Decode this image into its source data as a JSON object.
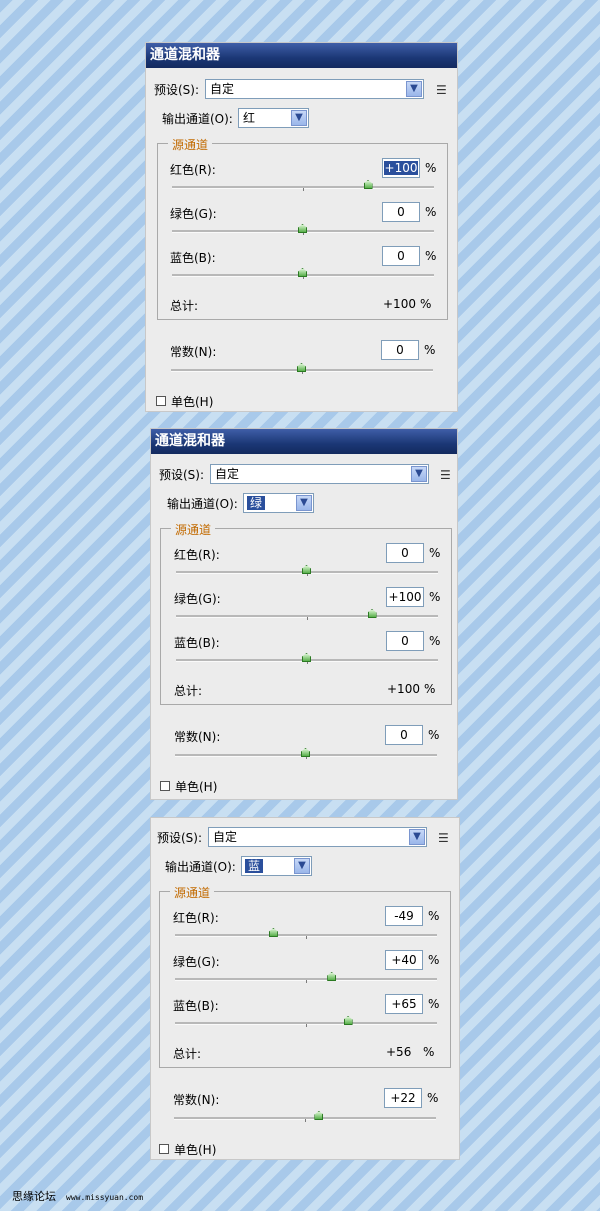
{
  "common": {
    "preset_label": "预设(S):",
    "output_label": "输出通道(O):",
    "source_legend": "源通道",
    "red_label": "红色(R):",
    "green_label": "绿色(G):",
    "blue_label": "蓝色(B):",
    "total_label": "总计:",
    "constant_label": "常数(N):",
    "mono_label": "单色(H)",
    "percent": "%",
    "combo_arrow_icon": "chevron-down-icon",
    "menu_icon": "panel-menu-icon",
    "slider_thumb_icon": "slider-thumb-icon"
  },
  "panels": [
    {
      "title": "通道混和器",
      "preset_value": "自定",
      "output_value": "红",
      "red": "+100",
      "green": "0",
      "blue": "0",
      "total": "+100",
      "constant": "0",
      "mono_checked": false,
      "slider_levels_percent": {
        "red": 100,
        "green": 0,
        "blue": 0,
        "constant": 0
      }
    },
    {
      "title": "通道混和器",
      "preset_value": "自定",
      "output_value": "绿",
      "red": "0",
      "green": "+100",
      "blue": "0",
      "total": "+100",
      "constant": "0",
      "mono_checked": false,
      "slider_levels_percent": {
        "red": 0,
        "green": 100,
        "blue": 0,
        "constant": 0
      }
    },
    {
      "title": "",
      "preset_value": "自定",
      "output_value": "蓝",
      "red": "-49",
      "green": "+40",
      "blue": "+65",
      "total": "+56",
      "constant": "+22",
      "mono_checked": false,
      "slider_levels_percent": {
        "red": -49,
        "green": 40,
        "blue": 65,
        "constant": 22
      }
    }
  ],
  "footer": {
    "site_name": "思缘论坛",
    "site_url": "www.missyuan.com"
  },
  "colors": {
    "title_bar": "#1b3775",
    "legend_text": "#c26a00",
    "selection": "#2a4f9c",
    "slider_thumb": "#58b04a"
  }
}
